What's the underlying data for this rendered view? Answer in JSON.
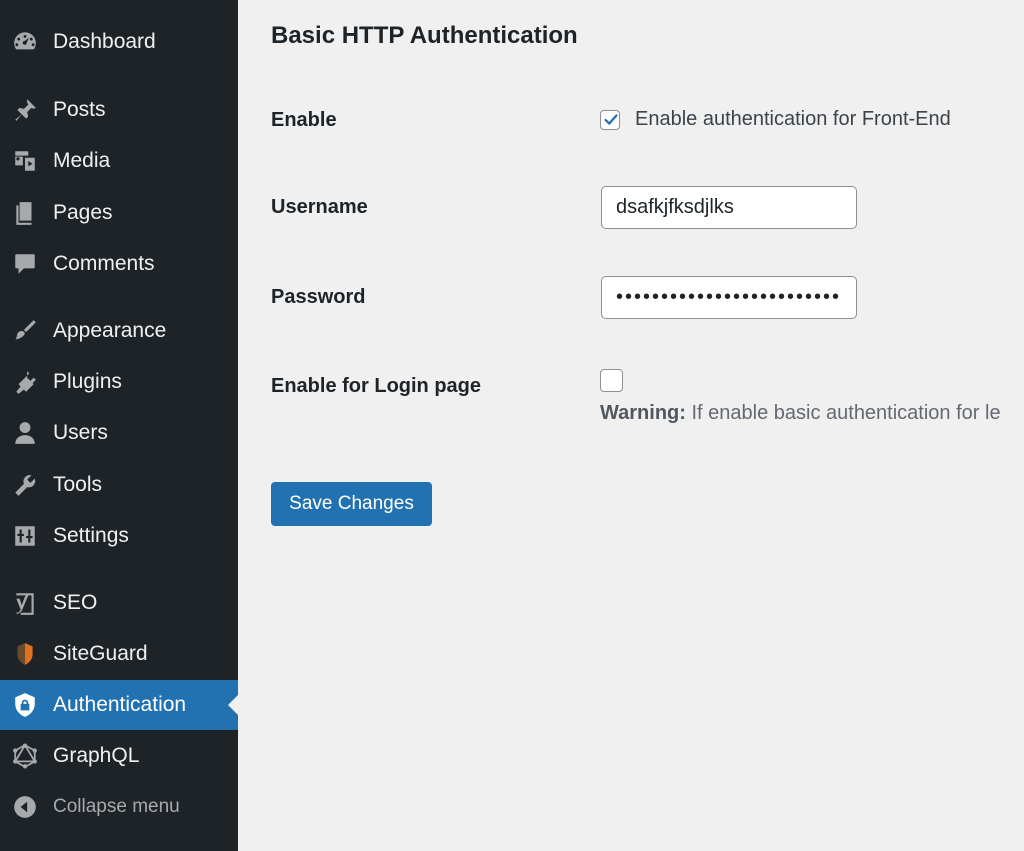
{
  "sidebar": {
    "items": [
      {
        "label": "Dashboard",
        "icon": "dashboard-icon"
      },
      {
        "label": "Posts",
        "icon": "pushpin-icon"
      },
      {
        "label": "Media",
        "icon": "media-icon"
      },
      {
        "label": "Pages",
        "icon": "pages-icon"
      },
      {
        "label": "Comments",
        "icon": "comment-icon"
      },
      {
        "label": "Appearance",
        "icon": "paintbrush-icon"
      },
      {
        "label": "Plugins",
        "icon": "plugin-icon"
      },
      {
        "label": "Users",
        "icon": "user-icon"
      },
      {
        "label": "Tools",
        "icon": "wrench-icon"
      },
      {
        "label": "Settings",
        "icon": "settings-icon"
      },
      {
        "label": "SEO",
        "icon": "yoast-icon"
      },
      {
        "label": "SiteGuard",
        "icon": "siteguard-shield-icon"
      },
      {
        "label": "Authentication",
        "icon": "shield-lock-icon",
        "active": true
      },
      {
        "label": "GraphQL",
        "icon": "graphql-icon"
      }
    ],
    "collapse_label": "Collapse menu"
  },
  "main": {
    "title": "Basic HTTP Authentication",
    "enable": {
      "label": "Enable",
      "checkbox_label": "Enable authentication for Front-End",
      "checked": true
    },
    "username": {
      "label": "Username",
      "value": "dsafkjfksdjlks"
    },
    "password": {
      "label": "Password",
      "masked": "•••••••••••••••••••••••••"
    },
    "login_page": {
      "label": "Enable for Login page",
      "checked": false,
      "warning_prefix": "Warning:",
      "warning_text": " If enable basic authentication for le"
    },
    "save_label": "Save Changes"
  },
  "colors": {
    "sidebar_bg": "#1d2327",
    "accent": "#2271b1",
    "page_bg": "#f0f0f1"
  }
}
